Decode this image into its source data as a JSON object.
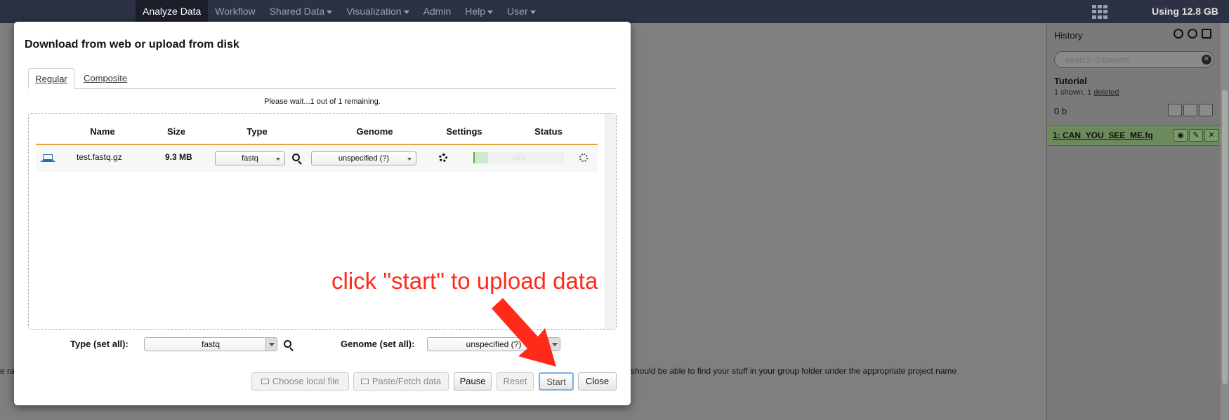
{
  "masthead": {
    "nav": [
      {
        "label": "Analyze Data",
        "has_caret": false
      },
      {
        "label": "Workflow",
        "has_caret": false
      },
      {
        "label": "Shared Data",
        "has_caret": true
      },
      {
        "label": "Visualization",
        "has_caret": true
      },
      {
        "label": "Admin",
        "has_caret": false
      },
      {
        "label": "Help",
        "has_caret": true
      },
      {
        "label": "User",
        "has_caret": true
      }
    ],
    "usage": "Using 12.8 GB"
  },
  "background": {
    "left_text": "e rav",
    "right_text": "should be able to find your stuff in your group folder under the appropriate project name"
  },
  "history": {
    "title": "History",
    "search_placeholder": "search datasets",
    "name": "Tutorial",
    "count_text": "1 shown, 1 ",
    "deleted_link": "deleted",
    "size": "0 b",
    "dataset_title": "1: CAN_YOU_SEE_ME.fq"
  },
  "modal": {
    "title": "Download from web or upload from disk",
    "tabs": [
      "Regular",
      "Composite"
    ],
    "wait_message": "Please wait...1 out of 1 remaining.",
    "columns": [
      "Name",
      "Size",
      "Type",
      "Genome",
      "Settings",
      "Status"
    ],
    "row": {
      "name": "test.fastq.gz",
      "size": "9.3 MB",
      "type": "fastq",
      "genome": "unspecified (?)",
      "progress_pct": 0.15,
      "progress_label": "15%"
    },
    "set_all": {
      "type_label": "Type (set all):",
      "type_value": "fastq",
      "genome_label": "Genome (set all):",
      "genome_value": "unspecified (?)"
    },
    "buttons": {
      "choose_local": "Choose local file",
      "paste_fetch": "Paste/Fetch data",
      "pause": "Pause",
      "reset": "Reset",
      "start": "Start",
      "close": "Close"
    }
  },
  "annotation": {
    "text": "click \"start\" to upload data",
    "color": "#ff2a1a"
  }
}
